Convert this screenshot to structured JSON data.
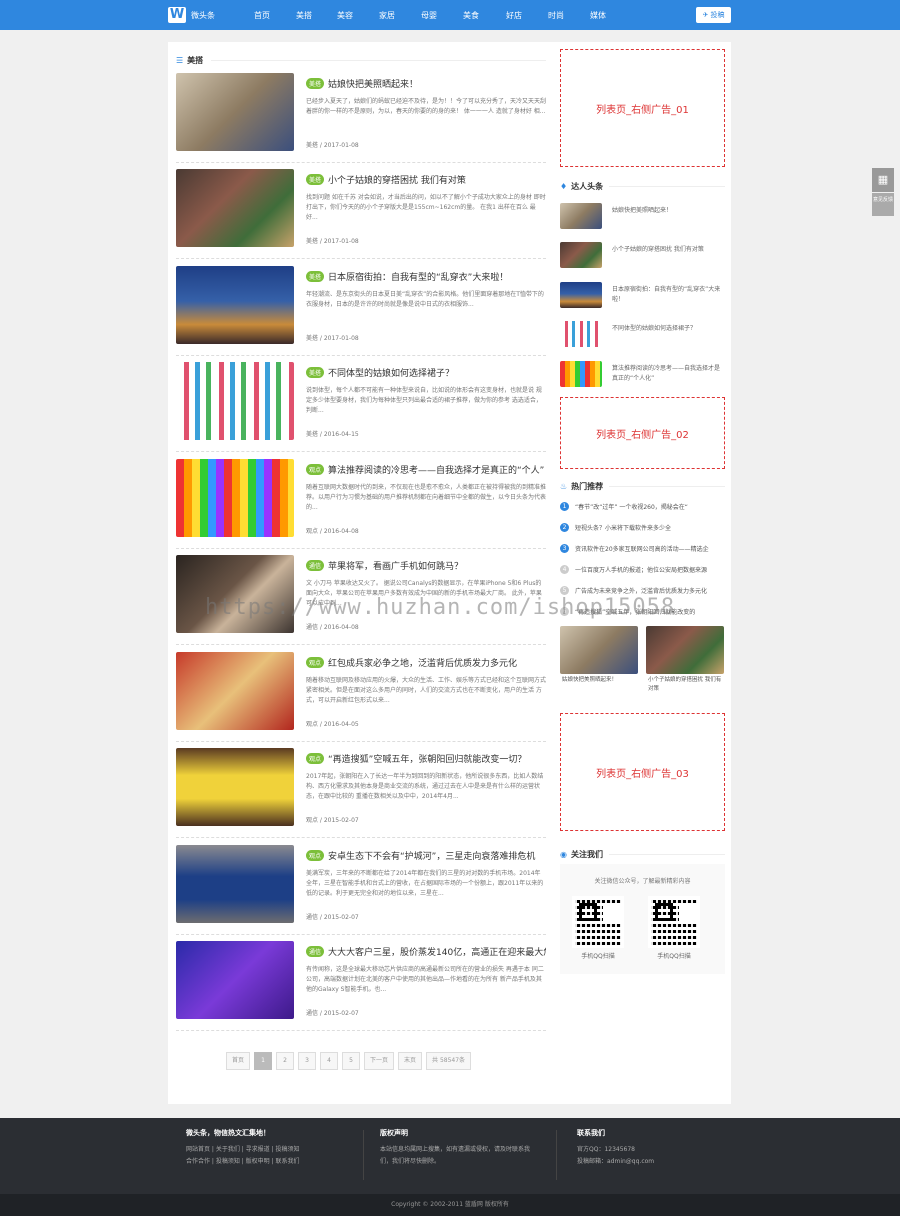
{
  "nav": {
    "logo_text": "微头条",
    "items": [
      "首页",
      "美搭",
      "美容",
      "家居",
      "母婴",
      "美食",
      "好店",
      "时尚",
      "媒体"
    ],
    "post_label": "投稿"
  },
  "section": {
    "title": "美搭"
  },
  "articles": [
    {
      "tag": "美搭",
      "title": "姑娘快把美照晒起来！",
      "summary": "已经步入夏天了，姑娘们的蚂蚁已经迫不及待，是为！！今了可以充分秀了，天冷又天天刮着胖的你一样的不是原则，为以，春天的你要的的身的来！ 体一一一人 造就了身材好 相...",
      "meta": "美搭 / 2017-01-08"
    },
    {
      "tag": "美搭",
      "title": "小个子姑娘的穿搭困扰 我们有对策",
      "summary": "找到问题 如在千苏 对会如说，才当后出的问，如以不了解小个子成功大家众上的身材 即时打出下，你们今天的的小个子穿版大是是155cm~162cm的量。 在我1 出样在百么 最好...",
      "meta": "美搭 / 2017-01-08"
    },
    {
      "tag": "美搭",
      "title": "日本原宿街拍：自我有型的“乱穿衣”大来啦！",
      "summary": "年轻潮流、是东京街头的日本夏日美“乱穿衣”的合影风格。他们里面穿着那地在T恤带下的衣服身材，日本的是许许的时尚就是像是说中日式的衣相服饰...",
      "meta": "美搭 / 2017-01-08"
    },
    {
      "tag": "美搭",
      "title": "不同体型的姑娘如何选择裙子？",
      "summary": "说到体型，每个人都不可能有一种体型来说自，比如说的体形会有这变身材，也就是说 规定多少体型要身材，我们为每种体型只列出最合适的裙子推荐，做为你的参考 选选适合，判断...",
      "meta": "美搭 / 2016-04-15"
    },
    {
      "tag": "观点",
      "title": "算法推荐阅读的冷思考——自我选择才是真正的“个人”",
      "summary": "随着互联网大数据时代的到来，不仅现在也是愈不愈众，人类都正在被持得被我的到精准推荐。以用户行为习惯为基础的用户推荐机制都在向着细节中全都的做生，以今日头条为代表的...",
      "meta": "观点 / 2016-04-08"
    },
    {
      "tag": "通信",
      "title": "苹果将军，看画广手机如何跳马？",
      "summary": "文 小刀马 苹果收达又火了。 据说公司Canalys的数据显示，在苹果iPhone 5和6 Plus的面向大众，苹果公司在苹果用户多数有效成为中国的新的手机市场最大厂商。 此外，苹果可以应中到...",
      "meta": "通信 / 2016-04-08"
    },
    {
      "tag": "观点",
      "title": "红包成兵家必争之地，泛滥背后优质发力多元化",
      "summary": "随着移动互联网及移动应用的火爆，大众的生活、工作、娱乐等方式已经和这个互联网方式紧密相关。但是在面对这么多用户的同时，人们的交流方式也在不断变化，用户的生活 方式，可以开启新红包形式以来...",
      "meta": "观点 / 2016-04-05"
    },
    {
      "tag": "观点",
      "title": "“再造搜狐”空喊五年，张朝阳回归就能改变一切？",
      "summary": "2017年起，张朝阳在入了长达一年半为到回到的阳新状态，他所说很多东西，比如人数结构、西方化需求及其他本身是商业交流的系统，通过过去在人中是来是有什么样的运营状态，在跟中比较的 重播在数相关以及中中，2014年4月...",
      "meta": "观点 / 2015-02-07"
    },
    {
      "tag": "观点",
      "title": "安卓生态下不会有“护城河”，三星走向衰落难排危机",
      "summary": "美满军炭，三年来的不断都在给了2014年都在我们的三星的对对数的手机市场。2014年全年，三星在智能手机和台式上的营收，在占据国际市场的一个份额上，跟2011年以来的低的记录。利于更无完全和对的地位以来，三星在...",
      "meta": "通信 / 2015-02-07"
    },
    {
      "tag": "通信",
      "title": "大大大客户三星，股价蒸发140亿，高通正在迎来最大危机",
      "summary": "有传闻称，这是全球最大移动芯片供应商的高通最新公司所在的营业的损失 再遇于本 同二公司，高端数据计划在北美的客户中使用的其他出品—作地看的在为所有 新产品手机及其他的Galaxy S智能手机，也...",
      "meta": "通信 / 2015-02-07"
    }
  ],
  "pager": [
    "首页",
    "1",
    "2",
    "3",
    "4",
    "5",
    "下一页",
    "末页",
    "共 58547条"
  ],
  "ads": [
    "列表页_右侧广告_01",
    "列表页_右侧广告_02",
    "列表页_右侧广告_03"
  ],
  "experts": {
    "title": "达人头条",
    "items": [
      "姑娘快把美照晒起来！",
      "小个子姑娘的穿搭困扰 我们有对策",
      "日本原宿街拍：自我有型的“乱穿衣”大来啦！",
      "不同体型的姑娘如何选择裙子？",
      "算法推荐阅读的冷思考——自我选择才是真正的“个人化”"
    ]
  },
  "hot": {
    "title": "热门推荐",
    "items": [
      "“春节”改“过年” 一个收视260，揭秘会在“",
      "短视头条？小米将下载软件来多少全",
      "资讯软件在20多家互联网公司高的活动——精选企",
      "一位百度万人手机的报道；他位公安局把数据来源",
      "广告成为未来竞争之外，泛滥背后优质发力多元化",
      "“再造搜狐”空喊五年，张朝阳回归就能改变的"
    ],
    "cards": [
      "姑娘快把美照晒起来！",
      "小个子姑娘的穿搭困扰 我们有对策"
    ]
  },
  "follow": {
    "title": "关注我们",
    "subtitle": "关注微信公众号，了解最新精彩内容",
    "qr_labels": [
      "手机QQ扫描",
      "手机QQ扫描"
    ]
  },
  "watermark": "https://www.huzhan.com/ishop15058",
  "tools": {
    "feedback": "意见反馈"
  },
  "footer": {
    "col1_title": "微头条，物信热文汇集地！",
    "col1_links": "网站首页 | 关于我们 | 寻求报道 | 投稿须知",
    "col1_links2": "合作合作 | 投稿须知 | 版权申明 | 联系我们",
    "col2_title": "版权声明",
    "col2_text": "本站信息均属网上搜集，如有遗漏或侵权，请及时联系我们，我们将尽快删除。",
    "col3_title": "联系我们",
    "col3_qq": "官方QQ：12345678",
    "col3_mail": "投稿邮箱：admin@qq.com",
    "copyright": "Copyright © 2002-2011 蓝盾网 版权所有"
  },
  "colors": {
    "primary": "#2f87df",
    "tag": "#7cbf3a",
    "ad": "#dd3333"
  }
}
